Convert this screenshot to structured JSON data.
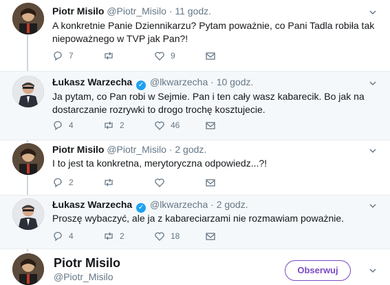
{
  "tweets": [
    {
      "name": "Piotr Misilo",
      "handle": "@Piotr_Misilo",
      "separator": "·",
      "time": "11 godz.",
      "verified": false,
      "text_lines": [
        "A konkretnie Panie Dziennikarzu? Pytam poważnie, co Pani Tadla robiła tak",
        "niepoważnego w TVP jak Pan?!"
      ],
      "replies": "7",
      "retweets": "",
      "likes": "9"
    },
    {
      "name": "Łukasz Warzecha",
      "handle": "@lkwarzecha",
      "separator": "·",
      "time": "10 godz.",
      "verified": true,
      "text_lines": [
        "Ja pytam, co Pan robi w Sejmie. Pan i ten cały wasz kabarecik. Bo jak na",
        "dostarczanie rozrywki to drogo trochę kosztujecie."
      ],
      "replies": "4",
      "retweets": "2",
      "likes": "46"
    },
    {
      "name": "Piotr Misilo",
      "handle": "@Piotr_Misilo",
      "separator": "·",
      "time": "2 godz.",
      "verified": false,
      "text_lines": [
        "I to jest ta konkretna, merytoryczna odpowiedz...?!"
      ],
      "replies": "2",
      "retweets": "",
      "likes": ""
    },
    {
      "name": "Łukasz Warzecha",
      "handle": "@lkwarzecha",
      "separator": "·",
      "time": "2 godz.",
      "verified": true,
      "text_lines": [
        "Proszę wybaczyć, ale ja z kabareciarzami nie rozmawiam poważnie."
      ],
      "replies": "4",
      "retweets": "2",
      "likes": "18"
    }
  ],
  "profile": {
    "name": "Piotr Misilo",
    "handle": "@Piotr_Misilo",
    "follow_label": "Obserwuj"
  },
  "colors": {
    "accent": "#794bc4",
    "muted": "#657786",
    "verified": "#1da1f2",
    "divider": "#e6ecf0"
  }
}
